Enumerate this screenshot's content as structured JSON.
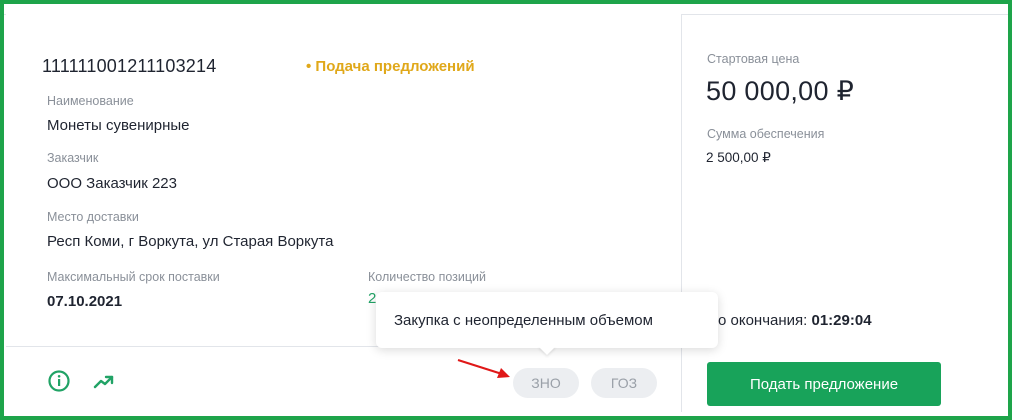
{
  "card": {
    "number": "111111001211103214",
    "status": "• Подача предложений",
    "name_label": "Наименование",
    "name_value": "Монеты сувенирные",
    "customer_label": "Заказчик",
    "customer_value": "ООО Заказчик 223",
    "delivery_label": "Место доставки",
    "delivery_value": "Респ Коми, г Воркута, ул Старая Воркута",
    "max_term_label": "Максимальный срок поставки",
    "max_term_value": "07.10.2021",
    "positions_label": "Количество позиций",
    "positions_value": "2",
    "tags": [
      "ЗНО",
      "ГОЗ"
    ],
    "tooltip": "Закупка с неопределенным объемом"
  },
  "price_panel": {
    "start_price_label": "Стартовая цена",
    "start_price_value": "50 000,00 ₽",
    "deposit_label": "Сумма обеспечения",
    "deposit_value": "2 500,00 ₽",
    "countdown_label": "о окончания: ",
    "countdown_value": "01:29:04",
    "submit_label": "Подать предложение"
  },
  "colors": {
    "accent_green": "#18a35a",
    "status_yellow": "#e0a81a",
    "border_green": "#1ea44a"
  },
  "icons": [
    "info-circle-icon",
    "trending-up-icon",
    "red-arrow-icon"
  ]
}
